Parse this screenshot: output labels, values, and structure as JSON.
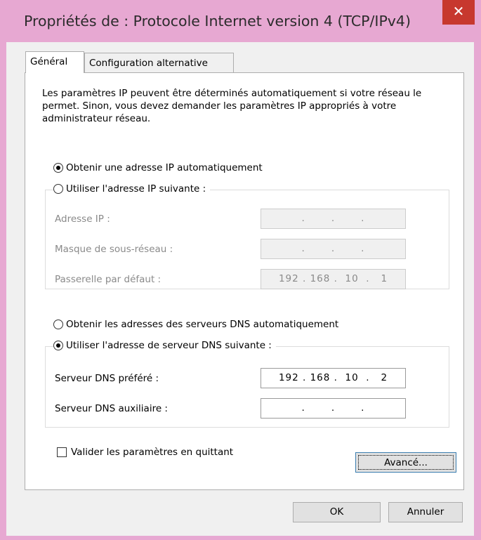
{
  "window": {
    "title": "Propriétés de : Protocole Internet version 4 (TCP/IPv4)",
    "close_glyph": "✕"
  },
  "tabs": [
    {
      "label": "Général",
      "active": true
    },
    {
      "label": "Configuration alternative",
      "active": false
    }
  ],
  "general": {
    "description": "Les paramètres IP peuvent être déterminés automatiquement si votre réseau le permet. Sinon, vous devez demander les paramètres IP appropriés à votre administrateur réseau.",
    "ip_auto_label": "Obtenir une adresse IP automatiquement",
    "ip_manual_label": "Utiliser l'adresse IP suivante :",
    "ip_mode": "auto",
    "ip_fields": {
      "address_label": "Adresse IP :",
      "address_value": ".       .       .",
      "mask_label": "Masque de sous-réseau :",
      "mask_value": ".       .       .",
      "gateway_label": "Passerelle par défaut :",
      "gateway_value": "192 . 168 .  10  .   1"
    },
    "dns_auto_label": "Obtenir les adresses des serveurs DNS automatiquement",
    "dns_manual_label": "Utiliser l'adresse de serveur DNS suivante :",
    "dns_mode": "manual",
    "dns_fields": {
      "preferred_label": "Serveur DNS préféré :",
      "preferred_value": "192 . 168 .  10  .   2",
      "alternate_label": "Serveur DNS auxiliaire :",
      "alternate_value": ".       .       ."
    },
    "validate_label": "Valider les paramètres en quittant",
    "validate_checked": false,
    "advanced_label": "Avancé..."
  },
  "footer": {
    "ok_label": "OK",
    "cancel_label": "Annuler"
  },
  "colors": {
    "window_frame": "#e7a8d2",
    "close_button": "#c7382e",
    "client_bg": "#f0f0f0"
  }
}
